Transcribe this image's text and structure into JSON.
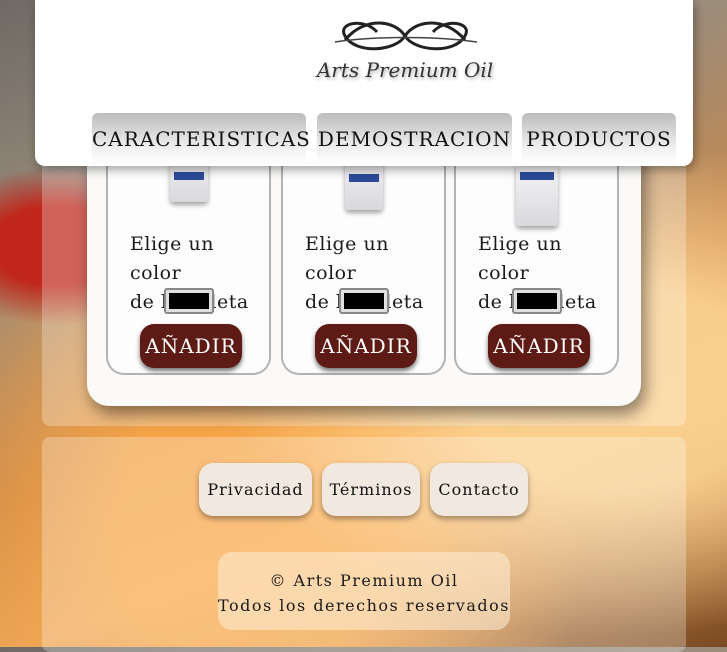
{
  "brand": {
    "logo_text": "Arts Premium Oil"
  },
  "nav": {
    "items": [
      {
        "label": "CARACTERISTICAS"
      },
      {
        "label": "DEMOSTRACION"
      },
      {
        "label": "PRODUCTOS"
      }
    ]
  },
  "products": [
    {
      "prompt_line1": "Elige un color",
      "prompt_line2": "de la paleta",
      "color_value": "#000000",
      "button_label": "AÑADIR"
    },
    {
      "prompt_line1": "Elige un color",
      "prompt_line2": "de la paleta",
      "color_value": "#000000",
      "button_label": "AÑADIR"
    },
    {
      "prompt_line1": "Elige un color",
      "prompt_line2": "de la paleta",
      "color_value": "#000000",
      "button_label": "AÑADIR"
    }
  ],
  "footer": {
    "links": [
      {
        "label": "Privacidad"
      },
      {
        "label": "Términos"
      },
      {
        "label": "Contacto"
      }
    ],
    "copyright_line1": "© Arts Premium Oil",
    "copyright_line2": "Todos los derechos reservados"
  },
  "colors": {
    "button": "#5e1a14",
    "accent_blue": "#2b4a9a"
  },
  "icons": [
    "paint-tube-icon",
    "logo-flourish-icon"
  ]
}
